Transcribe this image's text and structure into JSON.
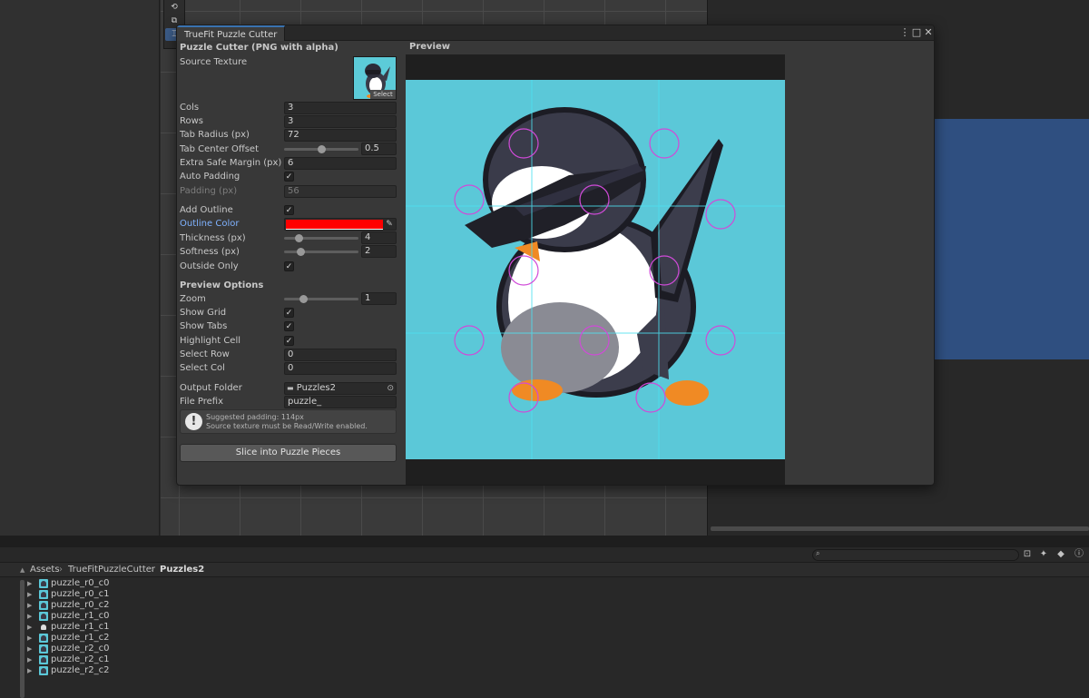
{
  "window": {
    "tab_title": "TrueFit Puzzle Cutter",
    "menu_icon": "⋮",
    "maximize_icon": "□",
    "close_icon": "✕"
  },
  "inspector": {
    "header": "Puzzle Cutter (PNG with alpha)",
    "source_texture_label": "Source Texture",
    "select_label": "Select",
    "cols_label": "Cols",
    "cols_value": "3",
    "rows_label": "Rows",
    "rows_value": "3",
    "tab_radius_label": "Tab Radius (px)",
    "tab_radius_value": "72",
    "tab_center_offset_label": "Tab Center Offset",
    "tab_center_offset_value": "0.5",
    "tab_center_offset_fraction": 0.5,
    "extra_safe_margin_label": "Extra Safe Margin (px)",
    "extra_safe_margin_value": "6",
    "auto_padding_label": "Auto Padding",
    "auto_padding_checked": true,
    "padding_label": "Padding (px)",
    "padding_value": "56",
    "add_outline_label": "Add Outline",
    "add_outline_checked": true,
    "outline_color_label": "Outline Color",
    "outline_color": "#ff0000",
    "thickness_label": "Thickness (px)",
    "thickness_value": "4",
    "softness_label": "Softness (px)",
    "softness_value": "2",
    "outside_only_label": "Outside Only",
    "outside_only_checked": true,
    "preview_options_header": "Preview Options",
    "zoom_label": "Zoom",
    "zoom_value": "1",
    "show_grid_label": "Show Grid",
    "show_grid_checked": true,
    "show_tabs_label": "Show Tabs",
    "show_tabs_checked": true,
    "highlight_cell_label": "Highlight Cell",
    "highlight_cell_checked": true,
    "select_row_label": "Select Row",
    "select_row_value": "0",
    "select_col_label": "Select Col",
    "select_col_value": "0",
    "output_folder_label": "Output Folder",
    "output_folder_value": "Puzzles2",
    "file_prefix_label": "File Prefix",
    "file_prefix_value": "puzzle_",
    "help_line1": "Suggested padding: 114px",
    "help_line2": "Source texture must be Read/Write enabled.",
    "slice_button": "Slice into Puzzle Pieces",
    "check_glyph": "✓"
  },
  "preview": {
    "label": "Preview",
    "background_color": "#5bc8d8",
    "grid_cols": 3,
    "grid_rows": 3
  },
  "project": {
    "breadcrumb": [
      "Assets",
      "TrueFitPuzzleCutter",
      "Puzzles2"
    ],
    "assets": [
      "puzzle_r0_c0",
      "puzzle_r0_c1",
      "puzzle_r0_c2",
      "puzzle_r1_c0",
      "puzzle_r1_c1",
      "puzzle_r1_c2",
      "puzzle_r2_c0",
      "puzzle_r2_c1",
      "puzzle_r2_c2"
    ]
  }
}
